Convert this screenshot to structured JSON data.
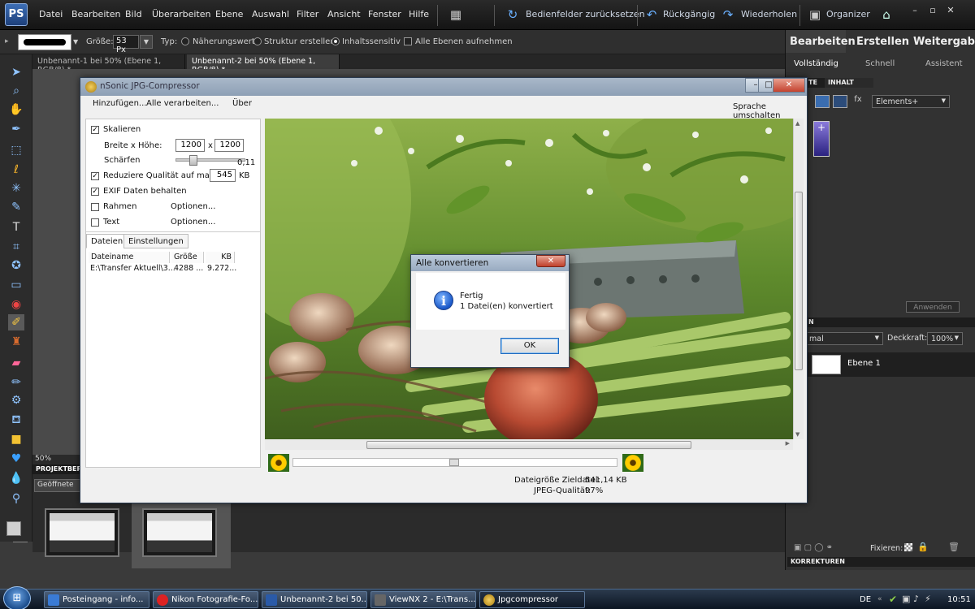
{
  "menubar": {
    "logo": "PS",
    "items": [
      "Datei",
      "Bearbeiten",
      "Bild",
      "Überarbeiten",
      "Ebene",
      "Auswahl",
      "Filter",
      "Ansicht",
      "Fenster",
      "Hilfe"
    ],
    "reset_panels": "Bedienfelder zurücksetzen",
    "undo": "Rückgängig",
    "redo": "Wiederholen",
    "organizer": "Organizer"
  },
  "options": {
    "size_label": "Größe:",
    "size_value": "53 Px",
    "type_label": "Typ:",
    "type_options": [
      "Näherungswert",
      "Struktur erstellen",
      "Inhaltssensitiv"
    ],
    "selected_type": "Inhaltssensitiv",
    "all_layers": "Alle Ebenen aufnehmen"
  },
  "doc_tabs": [
    "Unbenannt-1 bei 50% (Ebene 1, RGB/8) *",
    "Unbenannt-2 bei 50% (Ebene 1, RGB/8) *"
  ],
  "zoom": "50%",
  "project_bin": {
    "header": "PROJEKTBER",
    "select": "Geöffnete"
  },
  "right_panel": {
    "modes": [
      "Bearbeiten",
      "Erstellen",
      "Weitergabe"
    ],
    "submodes": [
      "Vollständig",
      "Schnell",
      "Assistent"
    ],
    "effects_tabs": [
      "TE",
      "INHALT"
    ],
    "elements_dropdown": "Elements+",
    "apply": "Anwenden",
    "layers_header": "N",
    "blend_mode": "mal",
    "opacity_label": "Deckkraft:",
    "opacity_value": "100%",
    "layer_name": "Ebene 1",
    "fix_label": "Fixieren:",
    "corrections": "KORREKTUREN"
  },
  "jpg": {
    "title": "nSonic JPG-Compressor",
    "menu": {
      "add": "Hinzufügen...",
      "process_all": "Alle verarbeiten...",
      "about": "Über",
      "language": "Sprache umschalten"
    },
    "scale": "Skalieren",
    "wh_label": "Breite x Höhe:",
    "width": "1200",
    "x": "x",
    "height": "1200",
    "sharpen_label": "Schärfen",
    "sharpen_value": "0,11",
    "reduce_quality": "Reduziere Qualität auf max.",
    "max_kb": "545",
    "kb": "KB",
    "exif": "EXIF Daten behalten",
    "frame": "Rahmen",
    "text": "Text",
    "options": "Optionen...",
    "tabs": [
      "Dateien",
      "Einstellungen"
    ],
    "columns": [
      "Dateiname",
      "Größe",
      "KB"
    ],
    "rows": [
      [
        "E:\\Transfer Aktuell\\3...",
        "4288 ...",
        "9.272..."
      ]
    ],
    "target_size_label": "Dateigröße Zieldatei:",
    "target_size_value": "541,14 KB",
    "quality_label": "JPEG-Qualität:",
    "quality_value": "97%"
  },
  "dialog": {
    "title": "Alle konvertieren",
    "line1": "Fertig",
    "line2": "1 Datei(en) konvertiert",
    "ok": "OK"
  },
  "taskbar": {
    "buttons": [
      "Posteingang - info...",
      "Nikon Fotografie-Fo...",
      "Unbenannt-2 bei 50...",
      "ViewNX 2 - E:\\Trans...",
      "Jpgcompressor"
    ],
    "lang": "DE",
    "clock": "10:51"
  },
  "colors": {
    "accent": "#3d6fb6",
    "dialog_title": "#98aac0"
  }
}
